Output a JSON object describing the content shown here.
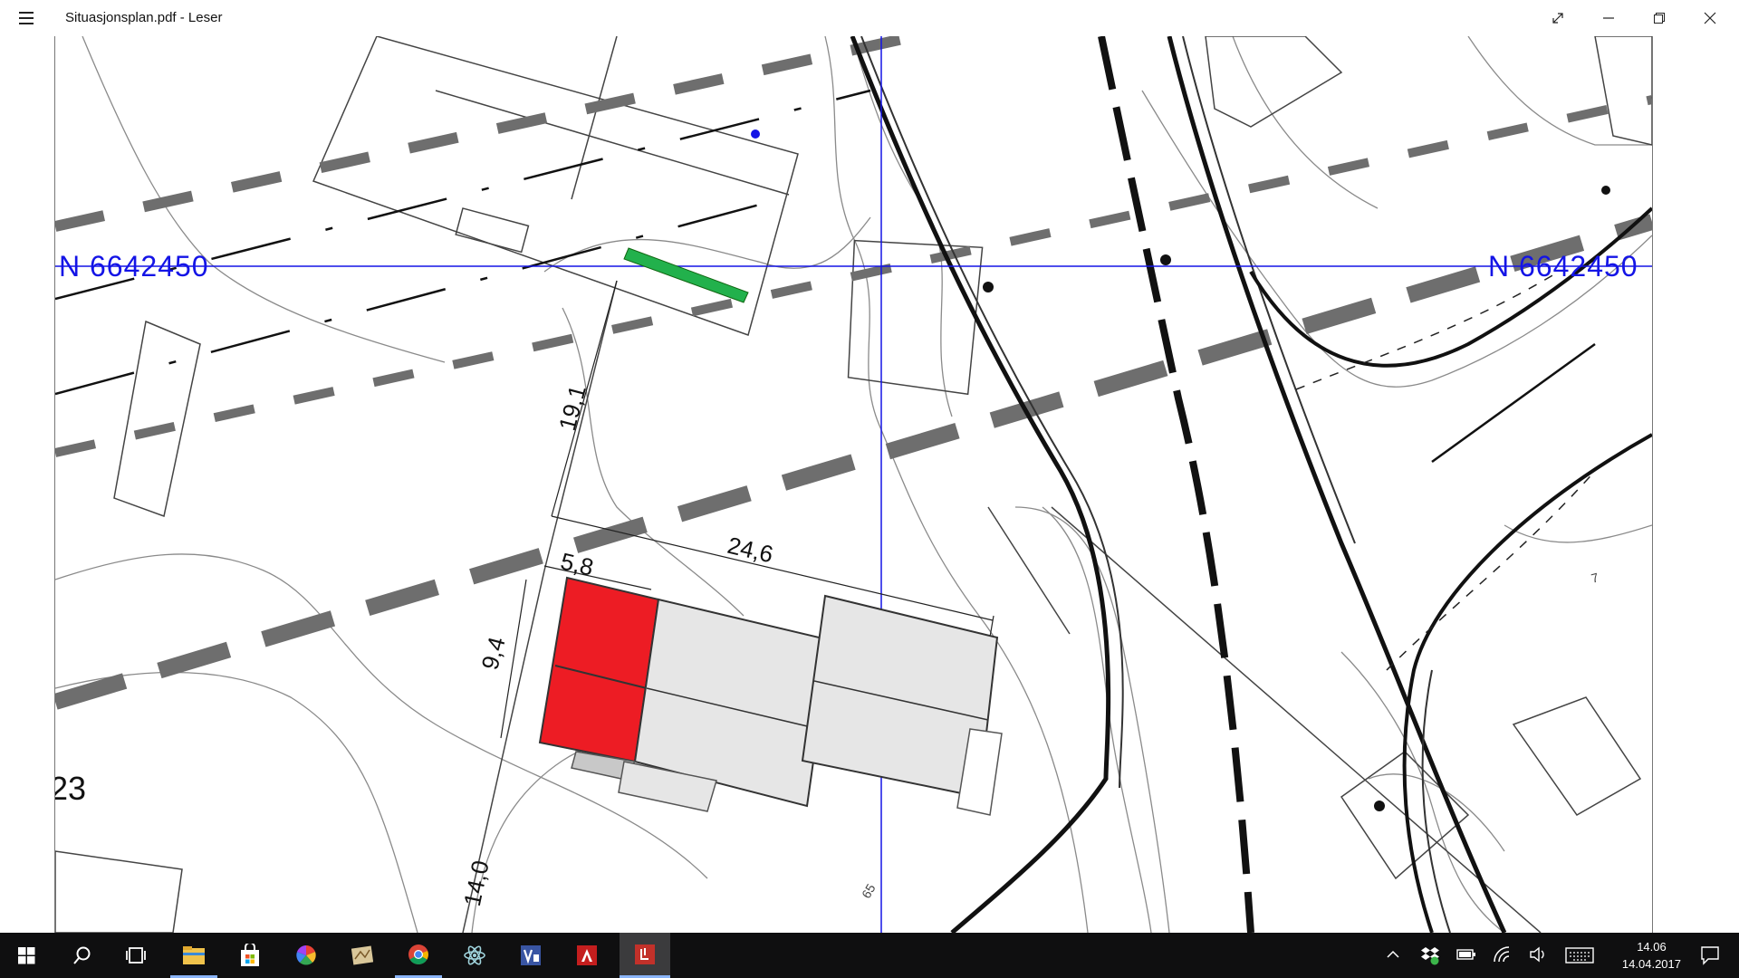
{
  "window": {
    "title": "Situasjonsplan.pdf - Leser"
  },
  "document": {
    "coordinate_label": "N 6642450",
    "coordinate_label_right": "N 6642450",
    "dimensions": {
      "dim_19_1": "19,1",
      "dim_24_6": "24,6",
      "dim_5_8": "5,8",
      "dim_9_4": "9,4",
      "dim_14_0": "14,0"
    },
    "labels": {
      "plot_number": "23",
      "contour_65": "65",
      "small_mark": "7"
    },
    "colors": {
      "grid_line": "#1414e6",
      "new_building": "#ed1c24",
      "existing_building": "#e6e6e6",
      "green_marker": "#22b14c"
    }
  },
  "taskbar": {
    "icons": [
      "start-icon",
      "search-icon",
      "task-view-icon",
      "file-explorer-icon",
      "store-icon",
      "picasa-icon",
      "maps-icon",
      "chrome-icon",
      "atom-icon",
      "visio-icon",
      "autocad-icon",
      "pdf-reader-icon"
    ],
    "clock_time": "14.06",
    "clock_date": "14.04.2017"
  }
}
